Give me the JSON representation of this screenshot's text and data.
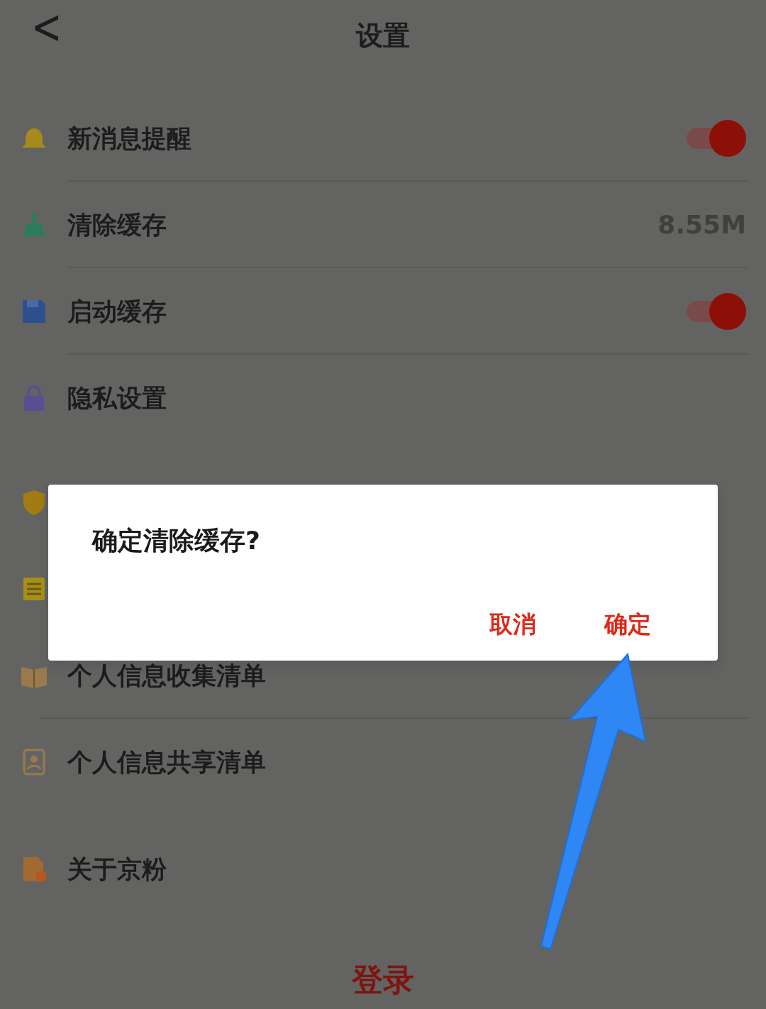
{
  "header": {
    "back": "<",
    "title": "设置"
  },
  "items": [
    {
      "kind": "toggle",
      "label": "新消息提醒",
      "on": true
    },
    {
      "kind": "value",
      "label": "清除缓存",
      "value": "8.55M"
    },
    {
      "kind": "toggle",
      "label": "启动缓存",
      "on": true
    },
    {
      "kind": "link",
      "label": "隐私设置"
    },
    {
      "kind": "link"
    },
    {
      "kind": "link"
    },
    {
      "kind": "link",
      "label": "个人信息收集清单"
    },
    {
      "kind": "link",
      "label": "个人信息共享清单"
    },
    {
      "kind": "link",
      "label": "关于京粉"
    }
  ],
  "login": "登录",
  "dialog": {
    "message": "确定清除缓存?",
    "buttons": [
      "取消",
      "确定"
    ]
  }
}
